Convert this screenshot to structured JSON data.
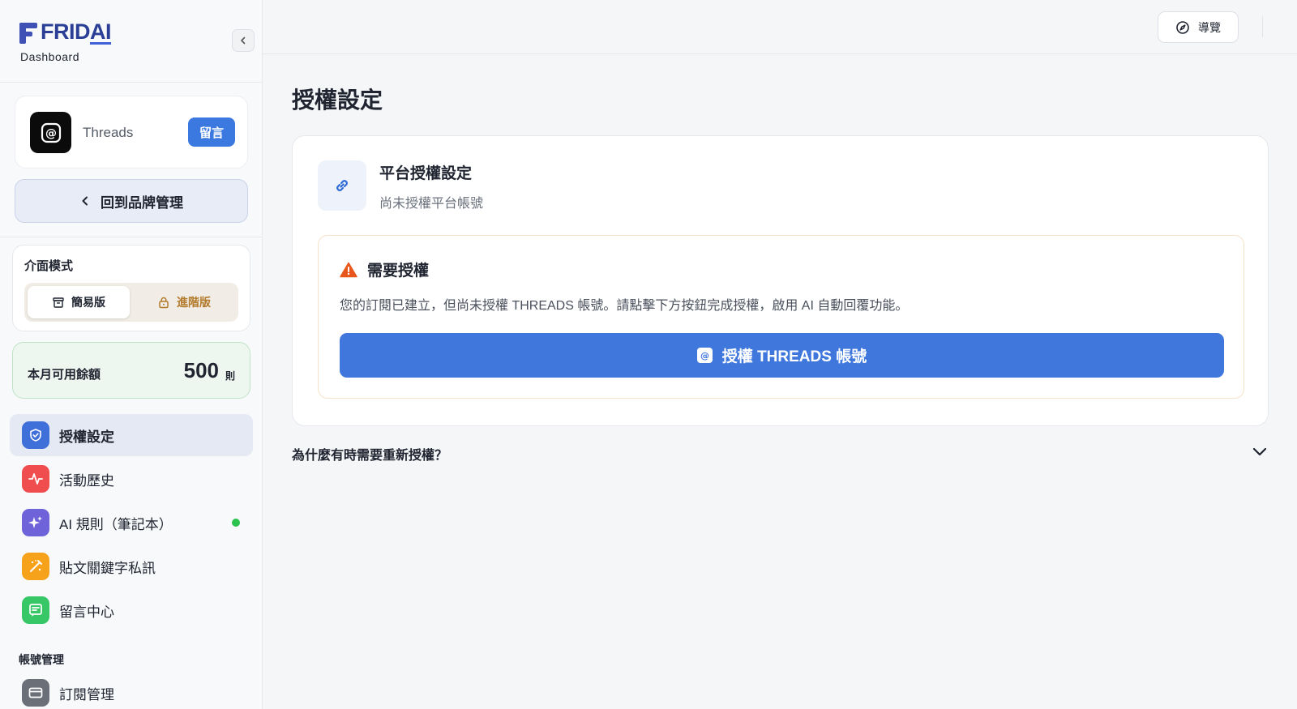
{
  "brand": {
    "logo_prefix": "FRID",
    "logo_suffix": "AI",
    "dashboard_label": "Dashboard"
  },
  "platform": {
    "name": "Threads",
    "badge": "留言"
  },
  "back_button": {
    "label": "回到品牌管理"
  },
  "mode": {
    "title": "介面模式",
    "simple_label": "簡易版",
    "advanced_label": "進階版",
    "selected": "簡易版"
  },
  "balance": {
    "label": "本月可用餘額",
    "value": "500",
    "unit": "則"
  },
  "nav": {
    "items": [
      {
        "label": "授權設定",
        "icon": "shield-check-icon",
        "color": "#3f6fd8",
        "active": true
      },
      {
        "label": "活動歷史",
        "icon": "activity-icon",
        "color": "#f04e4e",
        "active": false
      },
      {
        "label": "AI 規則（筆記本）",
        "icon": "sparkles-icon",
        "color": "#6f63d9",
        "active": false,
        "status": "active-dot"
      },
      {
        "label": "貼文關鍵字私訊",
        "icon": "magic-wand-icon",
        "color": "#f7a21b",
        "active": false
      },
      {
        "label": "留言中心",
        "icon": "message-icon",
        "color": "#37c767",
        "active": false
      }
    ],
    "section_account": "帳號管理",
    "account_items": [
      {
        "label": "訂閱管理",
        "icon": "credit-card-icon",
        "color": "#6b6f78"
      }
    ]
  },
  "topbar": {
    "guide_label": "導覽"
  },
  "page": {
    "title": "授權設定"
  },
  "card": {
    "title": "平台授權設定",
    "subtitle": "尚未授權平台帳號",
    "alert": {
      "title": "需要授權",
      "message": "您的訂閱已建立，但尚未授權 THREADS 帳號。請點擊下方按鈕完成授權，啟用 AI 自動回覆功能。",
      "button_label": "授權 THREADS 帳號"
    }
  },
  "faq": {
    "question": "為什麼有時需要重新授權？"
  },
  "colors": {
    "accent": "#3f77dd",
    "warning": "#e8561b",
    "success": "#2bc24d"
  }
}
